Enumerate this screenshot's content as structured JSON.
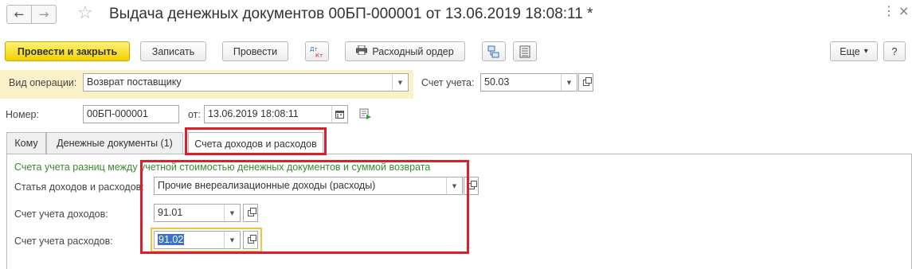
{
  "window": {
    "title": "Выдача денежных документов 00БП-000001 от 13.06.2019 18:08:11 *",
    "back_icon": "arrow-left-icon",
    "forward_icon": "arrow-right-icon",
    "favorite_icon": "star-icon",
    "back_glyph": "←",
    "forward_glyph": "→",
    "star_glyph": "☆",
    "more_glyph": "⋮",
    "close_glyph": "×"
  },
  "toolbar": {
    "post_and_close": "Провести и закрыть",
    "save": "Записать",
    "post": "Провести",
    "dt_kt": "Дт Кт",
    "cash_order": "Расходный ордер",
    "more": "Еще",
    "more_arrow": "▾",
    "help": "?",
    "accent_color": "#f2d100"
  },
  "form": {
    "operation_label": "Вид операции:",
    "operation_value": "Возврат поставщику",
    "account_label": "Счет учета:",
    "account_value": "50.03",
    "number_label": "Номер:",
    "number_value": "00БП-000001",
    "date_label": "от:",
    "date_value": "13.06.2019 18:08:11",
    "dropdown_glyph": "▼"
  },
  "tabs": [
    {
      "label": "Кому"
    },
    {
      "label": "Денежные документы (1)"
    },
    {
      "label": "Счета доходов и расходов",
      "active": true
    }
  ],
  "panel": {
    "caption": "Счета учета разниц между учетной стоимостью денежных документов и суммой возврата",
    "caption_color": "#3a8a2e",
    "income_expense_item_label": "Статья доходов и расходов:",
    "income_expense_item_value": "Прочие внереализационные доходы (расходы)",
    "income_account_label": "Счет учета доходов:",
    "income_account_value": "91.01",
    "expense_account_label": "Счет учета расходов:",
    "expense_account_value": "91.02"
  },
  "highlight_color": "#d9212d"
}
